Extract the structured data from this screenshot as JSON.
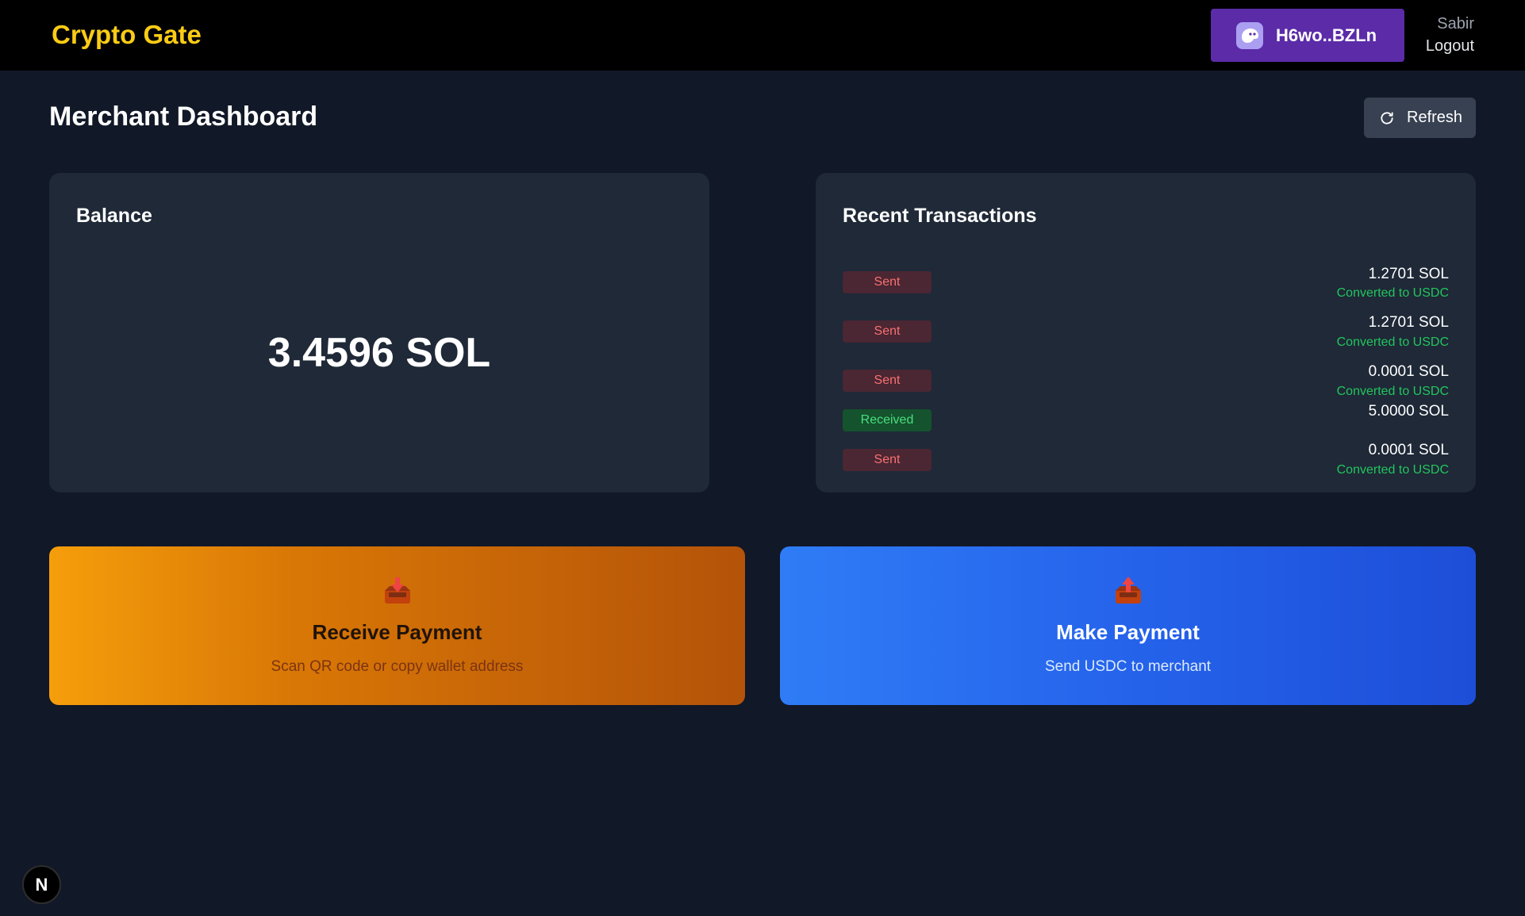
{
  "header": {
    "brand": "Crypto Gate",
    "wallet_label": "H6wo..BZLn",
    "user_name": "Sabir",
    "logout_label": "Logout"
  },
  "page": {
    "title": "Merchant Dashboard",
    "refresh_label": "Refresh"
  },
  "balance": {
    "title": "Balance",
    "value": "3.4596 SOL"
  },
  "transactions": {
    "title": "Recent Transactions",
    "items": [
      {
        "type": "Sent",
        "amount": "1.2701 SOL",
        "note": "Converted to USDC"
      },
      {
        "type": "Sent",
        "amount": "1.2701 SOL",
        "note": "Converted to USDC"
      },
      {
        "type": "Sent",
        "amount": "0.0001 SOL",
        "note": "Converted to USDC"
      },
      {
        "type": "Received",
        "amount": "5.0000 SOL",
        "note": ""
      },
      {
        "type": "Sent",
        "amount": "0.0001 SOL",
        "note": "Converted to USDC"
      }
    ]
  },
  "actions": {
    "receive": {
      "icon": "inbox-tray-icon",
      "title": "Receive Payment",
      "subtitle": "Scan QR code or copy wallet address"
    },
    "pay": {
      "icon": "outbox-tray-icon",
      "title": "Make Payment",
      "subtitle": "Send USDC to merchant"
    }
  },
  "corner_badge": {
    "label": "N"
  },
  "colors": {
    "background": "#111827",
    "card": "#1f2937",
    "brand": "#facc15",
    "wallet_button": "#5b2ba8",
    "sent_text": "#f87171",
    "received_text": "#4ade80",
    "converted_text": "#22c55e"
  }
}
